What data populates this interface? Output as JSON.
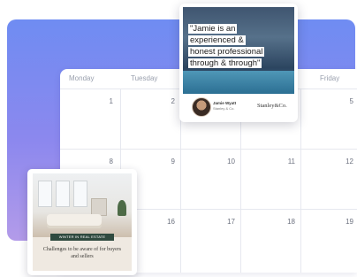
{
  "calendar": {
    "day_headers": [
      "Monday",
      "Tuesday",
      "Friday"
    ],
    "dates": [
      "1",
      "2",
      "5",
      "8",
      "9",
      "10",
      "11",
      "12",
      "16",
      "17",
      "18",
      "19"
    ]
  },
  "quote_card": {
    "quote_lines": [
      "\"Jamie is an",
      "experienced &",
      "honest professional",
      "through & through\""
    ],
    "agent_name": "Jamie Wyatt",
    "agent_company": "Stanley & Co.",
    "brand": "Stanley&Co."
  },
  "listing_card": {
    "tag": "WINTER IN REAL ESTATE",
    "text": "Challenges to be aware of for buyers and sellers"
  },
  "colors": {
    "backdrop_top": "#6f8cf2",
    "backdrop_bottom": "#b39be9",
    "tag_green": "#2f4a3f"
  }
}
